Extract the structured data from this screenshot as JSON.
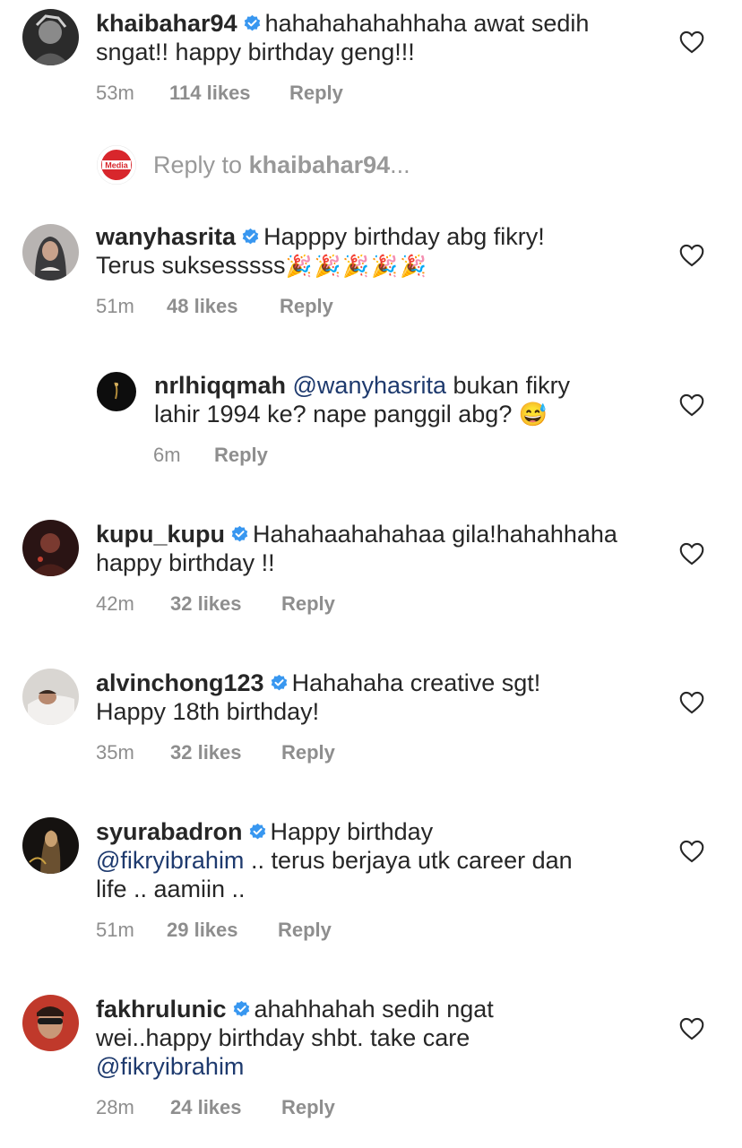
{
  "comments": [
    {
      "username": "khaibahar94",
      "line1": "hahahahahahhaha awat sedih",
      "line2": "sngat!! happy birthday geng!!!",
      "time": "53m",
      "likes": "114 likes",
      "reply": "Reply"
    },
    {
      "username": "wanyhasrita",
      "line1": "Happpy birthday abg fikry!",
      "line2": "Terus suksesssss",
      "emojis": "🎉🎉🎉🎉🎉",
      "time": "51m",
      "likes": "48 likes",
      "reply": "Reply"
    },
    {
      "username": "kupu_kupu",
      "line1": "Hahahaahahahaa gila!hahahhaha",
      "line2": "happy birthday !!",
      "time": "42m",
      "likes": "32 likes",
      "reply": "Reply"
    },
    {
      "username": "alvinchong123",
      "line1": "Hahahaha creative sgt!",
      "line2": "Happy 18th  birthday!",
      "time": "35m",
      "likes": "32 likes",
      "reply": "Reply"
    },
    {
      "username": "syurabadron",
      "line1": "Happy birthday",
      "line2_mention": "@fikryibrahim",
      "line2_rest": " .. terus berjaya utk career dan",
      "line3": "life .. aamiin ..",
      "time": "51m",
      "likes": "29 likes",
      "reply": "Reply"
    },
    {
      "username": "fakhrulunic",
      "line1": "ahahhahah sedih ngat",
      "line2": "wei..happy birthday shbt. take care",
      "line3_mention": "@fikryibrahim",
      "time": "28m",
      "likes": "24 likes",
      "reply": "Reply"
    }
  ],
  "reply_composer": {
    "prefix": "Reply to ",
    "target": "khaibahar94",
    "suffix": "...",
    "avatar_label": "Media"
  },
  "nested_reply": {
    "username": "nrlhiqqmah",
    "mention": "@wanyhasrita",
    "line1_rest": " bukan fikry",
    "line2": "lahir 1994 ke? nape panggil abg?",
    "emoji": "😅",
    "time": "6m",
    "reply": "Reply"
  },
  "colors": {
    "text": "#262626",
    "meta": "#8e8e8e",
    "verified": "#3897f0",
    "mention": "#1e3a6e",
    "media_red": "#d8262c"
  }
}
